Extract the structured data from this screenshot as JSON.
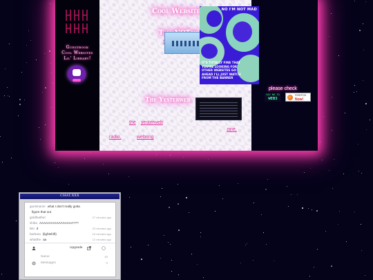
{
  "site": {
    "left": {
      "labels": [
        "Guestbook",
        "Cool Websites",
        "Lil' Library!"
      ]
    },
    "center": {
      "section_cool_websites": "Cool Websites",
      "section_tamanotchi": "TamaNOTchi",
      "link_tamanotchi": "tamanotchi",
      "section_yesterweb": "The Yesterweb",
      "link_the": "the",
      "link_yesterweb": "yesterweb",
      "link_zine": "zine,",
      "link_radio": "radio,",
      "link_webring": "webring"
    },
    "right": {
      "promo_title": "NO I'M NOT MAD",
      "promo_text": "IT'S TOTALLY FINE THAT YOU'RE LOOKING FOR OTHER WEBSITES GO AHEAD I'LL JUST WATCH FROM THE BANNER",
      "please_check": "please check",
      "web3_top": "SAY NO TO",
      "web3_main": "WEB3",
      "firefox_get": "FIREFOX",
      "firefox_now": "Now!"
    }
  },
  "chat": {
    "title": "CHAT.XXX",
    "messages": [
      {
        "user": "guestname",
        "text": "what I don't really gotta",
        "time": ""
      },
      {
        "user": "",
        "text": "figure that out",
        "time": ""
      },
      {
        "user": "goldfeather",
        "text": "",
        "time": "27 minutes ago"
      },
      {
        "user": "shiba",
        "text": "AAAAAAAAAAAAAAAA???",
        "time": ""
      },
      {
        "user": "kiki",
        "text": "d",
        "time": "23 minutes ago"
      },
      {
        "user": "barbara",
        "text": "(lightshift)",
        "time": "16 minutes ago"
      },
      {
        "user": "whatthe",
        "text": "aa",
        "time": "12 minutes ago"
      }
    ],
    "upgrade_label": "Upgrade",
    "name_label": "Name",
    "name_count": "40",
    "message_label": "Messages",
    "message_count": "0"
  },
  "colors": {
    "neon_pink": "#ff3fb0",
    "link_pink": "#e0329b",
    "chat_titlebar": "#1a1d80",
    "promo_blue": "#3a1bd6"
  },
  "icons": [
    "emblem-icon",
    "blinkie-icon",
    "user-icon",
    "external-link-icon",
    "emoji-icon",
    "gear-icon"
  ]
}
